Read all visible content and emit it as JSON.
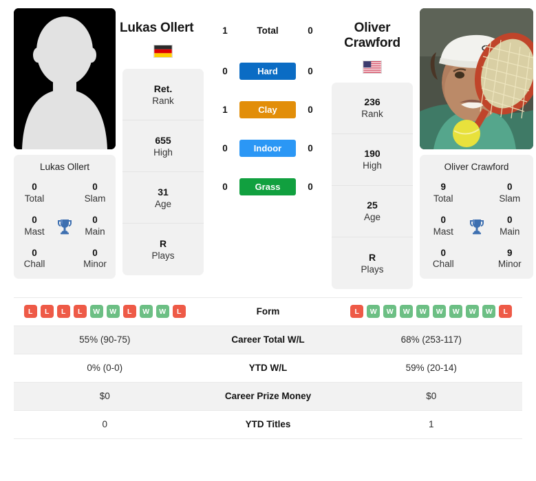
{
  "colors": {
    "hard": "#0b6cc4",
    "clay": "#e28e09",
    "indoor": "#2b97f5",
    "grass": "#11a03f",
    "win": "#6cbf84",
    "loss": "#ee5a47",
    "trophy": "#3d6fb0",
    "card_bg": "#f1f1f1",
    "row_alt_bg": "#f2f2f2"
  },
  "players": {
    "left": {
      "name": "Lukas Ollert",
      "country": "germany",
      "photo_type": "placeholder-avatar",
      "titles": {
        "total": {
          "num": "0",
          "label": "Total"
        },
        "slam": {
          "num": "0",
          "label": "Slam"
        },
        "mast": {
          "num": "0",
          "label": "Mast"
        },
        "main": {
          "num": "0",
          "label": "Main"
        },
        "chall": {
          "num": "0",
          "label": "Chall"
        },
        "minor": {
          "num": "0",
          "label": "Minor"
        }
      },
      "ranks": [
        {
          "num": "Ret.",
          "label": "Rank"
        },
        {
          "num": "655",
          "label": "High"
        },
        {
          "num": "31",
          "label": "Age"
        },
        {
          "num": "R",
          "label": "Plays"
        }
      ],
      "h2h": {
        "total": "1",
        "hard": "0",
        "clay": "1",
        "indoor": "0",
        "grass": "0"
      },
      "form": [
        "L",
        "L",
        "L",
        "L",
        "W",
        "W",
        "L",
        "W",
        "W",
        "L"
      ],
      "career_wl": "55% (90-75)",
      "ytd_wl": "0% (0-0)",
      "prize_money": "$0",
      "ytd_titles": "0"
    },
    "right": {
      "name": "Oliver Crawford",
      "country": "usa",
      "photo_type": "tennis-player-photo",
      "titles": {
        "total": {
          "num": "9",
          "label": "Total"
        },
        "slam": {
          "num": "0",
          "label": "Slam"
        },
        "mast": {
          "num": "0",
          "label": "Mast"
        },
        "main": {
          "num": "0",
          "label": "Main"
        },
        "chall": {
          "num": "0",
          "label": "Chall"
        },
        "minor": {
          "num": "9",
          "label": "Minor"
        }
      },
      "ranks": [
        {
          "num": "236",
          "label": "Rank"
        },
        {
          "num": "190",
          "label": "High"
        },
        {
          "num": "25",
          "label": "Age"
        },
        {
          "num": "R",
          "label": "Plays"
        }
      ],
      "h2h": {
        "total": "0",
        "hard": "0",
        "clay": "0",
        "indoor": "0",
        "grass": "0"
      },
      "form": [
        "L",
        "W",
        "W",
        "W",
        "W",
        "W",
        "W",
        "W",
        "W",
        "L"
      ],
      "career_wl": "68% (253-117)",
      "ytd_wl": "59% (20-14)",
      "prize_money": "$0",
      "ytd_titles": "1"
    }
  },
  "h2h_rows": [
    {
      "key": "total",
      "label": "Total",
      "badge": false
    },
    {
      "key": "hard",
      "label": "Hard",
      "badge": true,
      "color": "#0b6cc4"
    },
    {
      "key": "clay",
      "label": "Clay",
      "badge": true,
      "color": "#e28e09"
    },
    {
      "key": "indoor",
      "label": "Indoor",
      "badge": true,
      "color": "#2b97f5"
    },
    {
      "key": "grass",
      "label": "Grass",
      "badge": true,
      "color": "#11a03f"
    }
  ],
  "table": {
    "rows": [
      {
        "label": "Form",
        "type": "form"
      },
      {
        "label": "Career Total W/L",
        "type": "text",
        "left": "55% (90-75)",
        "right": "68% (253-117)"
      },
      {
        "label": "YTD W/L",
        "type": "text",
        "left": "0% (0-0)",
        "right": "59% (20-14)"
      },
      {
        "label": "Career Prize Money",
        "type": "text",
        "left": "$0",
        "right": "$0"
      },
      {
        "label": "YTD Titles",
        "type": "text",
        "left": "0",
        "right": "1"
      }
    ]
  }
}
